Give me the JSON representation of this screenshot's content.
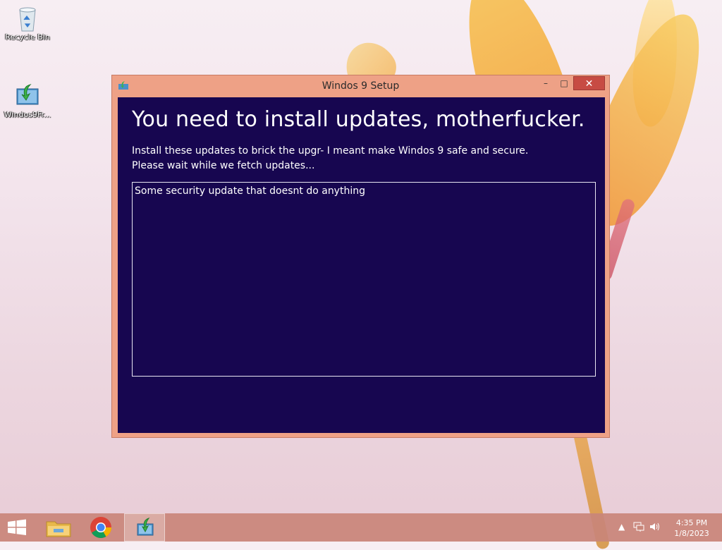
{
  "desktop": {
    "icons": [
      {
        "label": "Recycle Bin",
        "icon": "recycle-bin-icon"
      },
      {
        "label": "Windos9Fr...",
        "icon": "setup-download-icon"
      }
    ]
  },
  "window": {
    "title": "Windos 9 Setup",
    "controls": {
      "minimize": "–",
      "maximize": "□",
      "close": "✕"
    },
    "heading": "You need to install updates, motherfucker.",
    "description_line1": "Install these updates to brick the upgr- I meant make Windos 9 safe and secure.",
    "description_line2": "Please wait while we fetch updates...",
    "updates_list": [
      "Some security update that doesnt do anything"
    ]
  },
  "taskbar": {
    "items": [
      {
        "name": "file-explorer",
        "icon": "folder-icon"
      },
      {
        "name": "chrome",
        "icon": "chrome-icon"
      },
      {
        "name": "windos9-setup",
        "icon": "setup-download-icon",
        "active": true
      }
    ],
    "tray": {
      "time": "4:35 PM",
      "date": "1/8/2023"
    }
  },
  "colors": {
    "window_frame": "#eea186",
    "client_bg": "#170650",
    "close_button": "#c74b43",
    "taskbar": "#c98679"
  }
}
